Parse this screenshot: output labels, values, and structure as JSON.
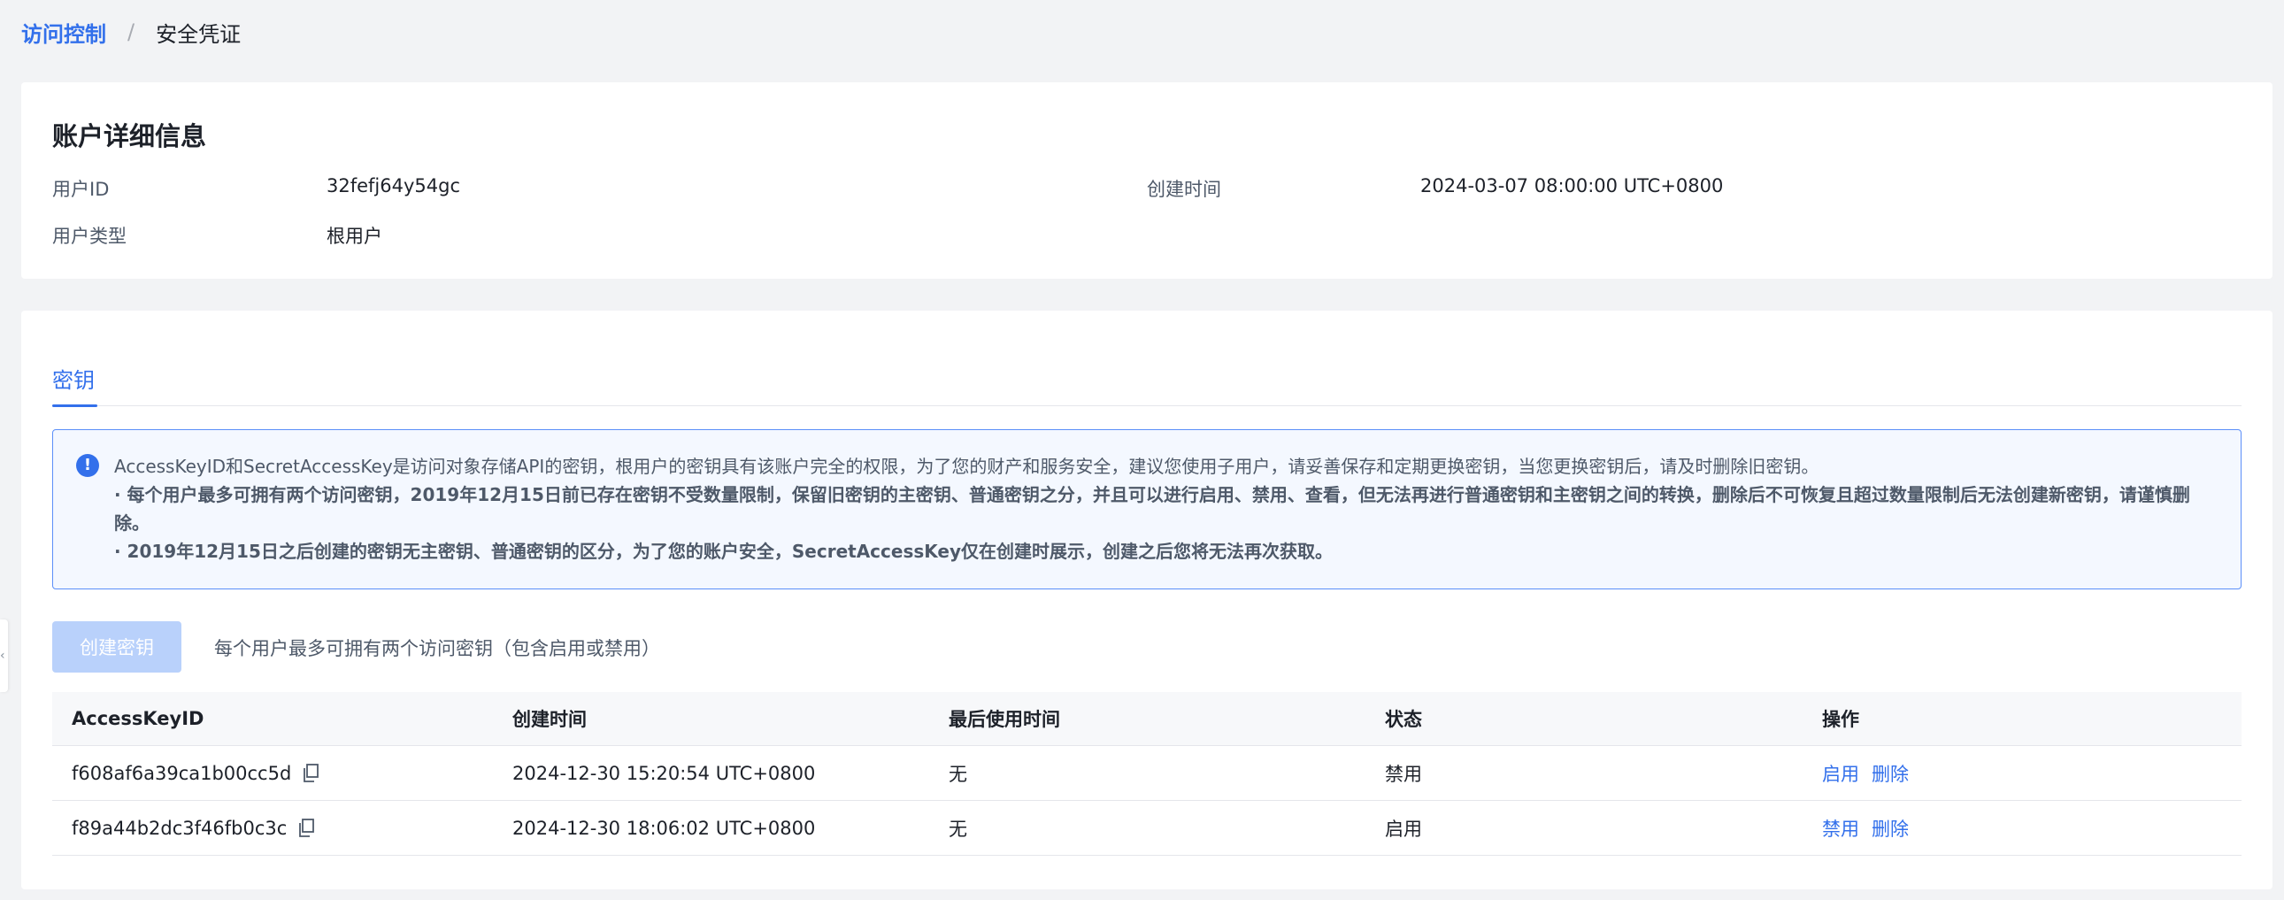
{
  "breadcrumb": {
    "parent": "访问控制",
    "separator": "/",
    "current": "安全凭证"
  },
  "account": {
    "title": "账户详细信息",
    "user_id_label": "用户ID",
    "user_id_value": "32fefj64y54gc",
    "created_label": "创建时间",
    "created_value": "2024-03-07 08:00:00 UTC+0800",
    "type_label": "用户类型",
    "type_value": "根用户"
  },
  "keys": {
    "tab_label": "密钥",
    "alert": {
      "icon": "info-icon",
      "line1": "AccessKeyID和SecretAccessKey是访问对象存储API的密钥，根用户的密钥具有该账户完全的权限，为了您的财产和服务安全，建议您使用子用户，请妥善保存和定期更换密钥，当您更换密钥后，请及时删除旧密钥。",
      "line2": "· 每个用户最多可拥有两个访问密钥，2019年12月15日前已存在密钥不受数量限制，保留旧密钥的主密钥、普通密钥之分，并且可以进行启用、禁用、查看，但无法再进行普通密钥和主密钥之间的转换，删除后不可恢复且超过数量限制后无法创建新密钥，请谨慎删除。",
      "line3": "· 2019年12月15日之后创建的密钥无主密钥、普通密钥的区分，为了您的账户安全，SecretAccessKey仅在创建时展示，创建之后您将无法再次获取。"
    },
    "create_button": "创建密钥",
    "hint": "每个用户最多可拥有两个访问密钥（包含启用或禁用）",
    "table": {
      "headers": [
        "AccessKeyID",
        "创建时间",
        "最后使用时间",
        "状态",
        "操作"
      ],
      "rows": [
        {
          "id": "f608af6a39ca1b00cc5d",
          "created": "2024-12-30 15:20:54 UTC+0800",
          "last_used": "无",
          "status": "禁用",
          "action_toggle": "启用",
          "action_delete": "删除"
        },
        {
          "id": "f89a44b2dc3f46fb0c3c",
          "created": "2024-12-30 18:06:02 UTC+0800",
          "last_used": "无",
          "status": "启用",
          "action_toggle": "禁用",
          "action_delete": "删除"
        }
      ]
    }
  },
  "colors": {
    "accent": "#3370eb",
    "background": "#f2f3f5",
    "alert_border": "#5b8ff9",
    "alert_bg": "#f4f8ff",
    "disabled_button": "#b9d1fb"
  }
}
